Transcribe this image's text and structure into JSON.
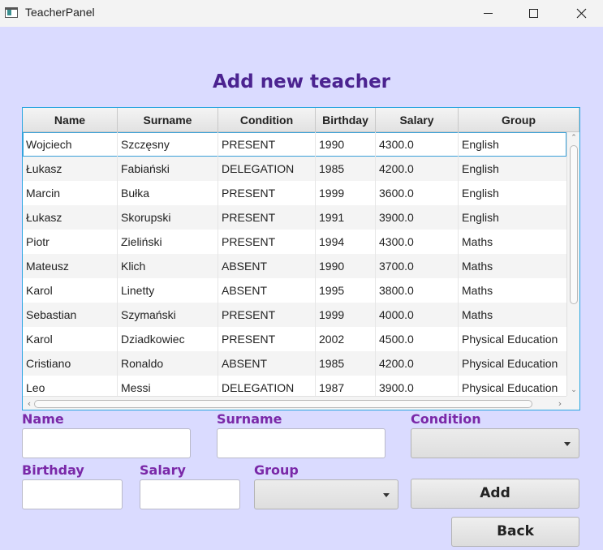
{
  "window": {
    "title": "TeacherPanel",
    "icon": "app-window-icon",
    "controls": [
      "minimize-icon",
      "maximize-icon",
      "close-icon"
    ]
  },
  "heading": "Add new teacher",
  "table": {
    "columns": [
      "Name",
      "Surname",
      "Condition",
      "Birthday",
      "Salary",
      "Group"
    ],
    "rows": [
      [
        "Wojciech",
        "Szczęsny",
        "PRESENT",
        "1990",
        "4300.0",
        "English"
      ],
      [
        "Łukasz",
        "Fabiański",
        "DELEGATION",
        "1985",
        "4200.0",
        "English"
      ],
      [
        "Marcin",
        "Bułka",
        "PRESENT",
        "1999",
        "3600.0",
        "English"
      ],
      [
        "Łukasz",
        "Skorupski",
        "PRESENT",
        "1991",
        "3900.0",
        "English"
      ],
      [
        "Piotr",
        "Zieliński",
        "PRESENT",
        "1994",
        "4300.0",
        "Maths"
      ],
      [
        "Mateusz",
        "Klich",
        "ABSENT",
        "1990",
        "3700.0",
        "Maths"
      ],
      [
        "Karol",
        "Linetty",
        "ABSENT",
        "1995",
        "3800.0",
        "Maths"
      ],
      [
        "Sebastian",
        "Szymański",
        "PRESENT",
        "1999",
        "4000.0",
        "Maths"
      ],
      [
        "Karol",
        "Dziadkowiec",
        "PRESENT",
        "2002",
        "4500.0",
        "Physical Education"
      ],
      [
        "Cristiano",
        "Ronaldo",
        "ABSENT",
        "1985",
        "4200.0",
        "Physical Education"
      ],
      [
        "Leo",
        "Messi",
        "DELEGATION",
        "1987",
        "3900.0",
        "Physical Education"
      ]
    ],
    "selected_row": 0
  },
  "form": {
    "name_label": "Name",
    "surname_label": "Surname",
    "condition_label": "Condition",
    "birthday_label": "Birthday",
    "salary_label": "Salary",
    "group_label": "Group",
    "name_value": "",
    "surname_value": "",
    "birthday_value": "",
    "salary_value": "",
    "condition_selected": "",
    "group_selected": ""
  },
  "buttons": {
    "add": "Add",
    "back": "Back"
  },
  "colors": {
    "background": "#dadbff",
    "heading": "#4b2390",
    "label": "#7a28a8",
    "table_border": "#2aa6e0"
  }
}
